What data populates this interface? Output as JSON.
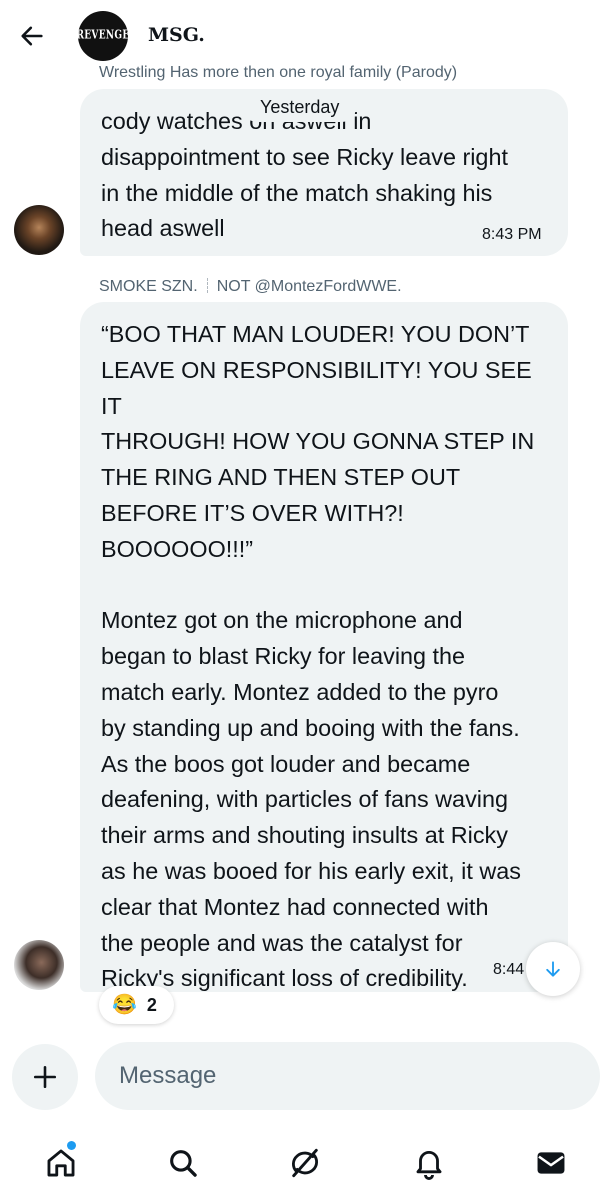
{
  "header": {
    "back_icon": "arrow-left-icon",
    "group_avatar_text": "REVENGE",
    "group_name": "MSG."
  },
  "messages": [
    {
      "sender": "Wrestling Has more then one royal family (Parody)",
      "text": "cody watches on aswell in\ndisappointment to see Ricky leave right\nin the middle of the match shaking his\nhead aswell",
      "time": "8:43 PM"
    },
    {
      "sender_name": "SMOKE SZN.",
      "sender_handle": "NOT @MontezFordWWE.",
      "text": "“BOO THAT MAN LOUDER! YOU DON’T\nLEAVE ON RESPONSIBILITY! YOU SEE IT\nTHROUGH! HOW YOU GONNA STEP IN\nTHE RING AND THEN STEP OUT\nBEFORE IT’S OVER WITH?!\nBOOOOOO!!!”\n\nMontez got on the microphone and\nbegan to blast Ricky for leaving the\nmatch early. Montez added to the pyro\nby standing up and booing with the fans.\nAs the boos got louder and became\ndeafening, with particles of fans waving\ntheir arms and shouting insults at Ricky\nas he was booed for his early exit, it was\nclear that Montez had connected with\nthe people and was the catalyst for\nRicky's significant loss of credibility.",
      "time": "8:44",
      "reaction": {
        "emoji": "😂",
        "count": "2"
      }
    }
  ],
  "date_separator": "Yesterday",
  "composer": {
    "placeholder": "Message",
    "add_icon": "plus-icon"
  },
  "scroll_down_icon": "arrow-down-icon",
  "nav": [
    "home-icon",
    "search-icon",
    "grok-icon",
    "bell-icon",
    "mail-icon"
  ],
  "colors": {
    "accent": "#1d9bf0",
    "bubble": "#eff3f4",
    "secondary_text": "#536471"
  }
}
